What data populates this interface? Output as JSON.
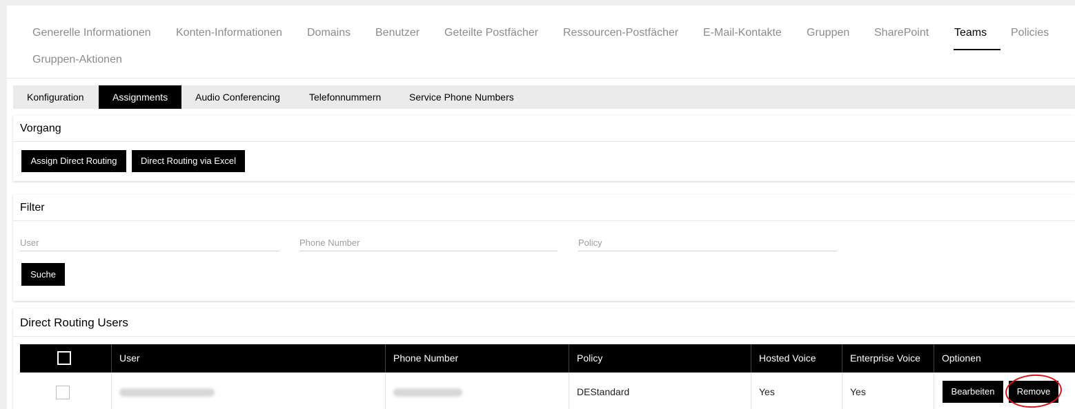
{
  "topnav": {
    "tabs": [
      {
        "label": "Generelle Informationen"
      },
      {
        "label": "Konten-Informationen"
      },
      {
        "label": "Domains"
      },
      {
        "label": "Benutzer"
      },
      {
        "label": "Geteilte Postfächer"
      },
      {
        "label": "Ressourcen-Postfächer"
      },
      {
        "label": "E-Mail-Kontakte"
      },
      {
        "label": "Gruppen"
      },
      {
        "label": "SharePoint"
      },
      {
        "label": "Teams",
        "active": true
      },
      {
        "label": "Policies"
      },
      {
        "label": "Gruppen-Aktionen"
      }
    ]
  },
  "subtabs": [
    {
      "label": "Konfiguration"
    },
    {
      "label": "Assignments",
      "active": true
    },
    {
      "label": "Audio Conferencing"
    },
    {
      "label": "Telefonnummern"
    },
    {
      "label": "Service Phone Numbers"
    }
  ],
  "vorgang": {
    "title": "Vorgang",
    "assign_label": "Assign Direct Routing",
    "excel_label": "Direct Routing via Excel"
  },
  "filter": {
    "title": "Filter",
    "user_placeholder": "User",
    "phone_placeholder": "Phone Number",
    "policy_placeholder": "Policy",
    "search_label": "Suche"
  },
  "table": {
    "title": "Direct Routing Users",
    "columns": [
      "User",
      "Phone Number",
      "Policy",
      "Hosted Voice",
      "Enterprise Voice",
      "Optionen"
    ],
    "rows": [
      {
        "policy": "DEStandard",
        "hosted_voice": "Yes",
        "enterprise_voice": "Yes",
        "edit_label": "Bearbeiten",
        "remove_label": "Remove"
      }
    ]
  },
  "colors": {
    "accent": "#000000",
    "annotation": "#e0101a",
    "inactive_tab": "#8c8c8c"
  }
}
